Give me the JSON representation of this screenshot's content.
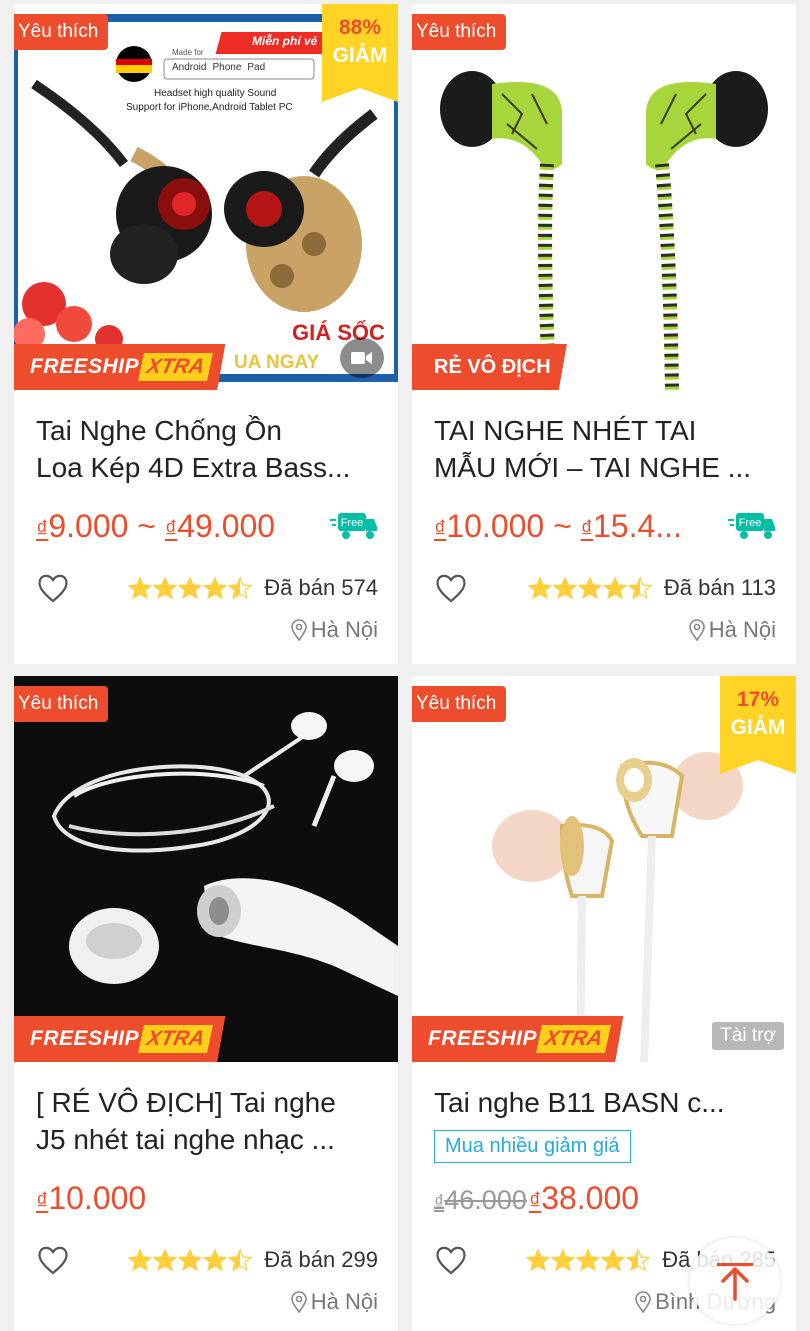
{
  "colors": {
    "accent": "#ee4d2d",
    "promo_yellow": "#ffd424",
    "link_blue": "#26aae1",
    "star": "#ffce3d"
  },
  "products": [
    {
      "badge": "Yêu thích",
      "discount": {
        "percent": "88%",
        "label": "GIẢM"
      },
      "ribbon": {
        "type": "freeship",
        "text": "FREESHIP",
        "extra": "XTRA"
      },
      "image_text": {
        "free_tag": "Miễn phí vé",
        "platforms": [
          "Android",
          "Phone",
          "Pad"
        ],
        "made_for": "Made for",
        "line1": "Headset high quality Sound",
        "line2": "Support for iPhone,Android Tablet PC",
        "shock": "GIÁ SỐC",
        "buy_now": "UA NGAY"
      },
      "has_video": true,
      "title_lines": [
        "Tai Nghe Chống Ồn",
        "Loa Kép 4D Extra Bass..."
      ],
      "price": {
        "currency": "₫",
        "low": "9.000",
        "sep": " ~ ",
        "high": "49.000"
      },
      "free_ship_icon": "Free",
      "rating": 4.5,
      "sold": "Đã bán 574",
      "location": "Hà Nội"
    },
    {
      "badge": "Yêu thích",
      "ribbon": {
        "type": "revo",
        "text": "RẺ VÔ ĐỊCH"
      },
      "title_lines": [
        "TAI NGHE NHÉT TAI",
        "MẪU MỚI – TAI NGHE ..."
      ],
      "price": {
        "currency": "₫",
        "low": "10.000",
        "sep": " ~ ",
        "high": "15.4..."
      },
      "free_ship_icon": "Free",
      "rating": 4.5,
      "sold": "Đã bán 113",
      "location": "Hà Nội"
    },
    {
      "badge": "Yêu thích",
      "ribbon": {
        "type": "freeship",
        "text": "FREESHIP",
        "extra": "XTRA"
      },
      "title_lines": [
        "[ RÉ VÔ ĐỊCH] Tai nghe",
        "J5 nhét tai nghe nhạc ..."
      ],
      "price": {
        "currency": "₫",
        "low": "10.000"
      },
      "rating": 4.5,
      "sold": "Đã bán 299",
      "location": "Hà Nội"
    },
    {
      "badge": "Yêu thích",
      "discount": {
        "percent": "17%",
        "label": "GIẢM"
      },
      "ribbon": {
        "type": "freeship",
        "text": "FREESHIP",
        "extra": "XTRA"
      },
      "sponsored": "Tài trợ",
      "title_lines": [
        "Tai nghe  B11 BASN c..."
      ],
      "promo_tag": "Mua nhiều giảm giá",
      "price": {
        "currency": "₫",
        "old": "46.000",
        "low": "38.000"
      },
      "rating": 4.5,
      "sold": "Đã bán 285",
      "location": "Bình Dương"
    }
  ],
  "icons": {
    "favorite": "heart-outline-icon",
    "location": "map-pin-icon",
    "scroll_top": "arrow-up-icon",
    "video": "video-camera-icon",
    "free_shipping": "truck-icon"
  }
}
